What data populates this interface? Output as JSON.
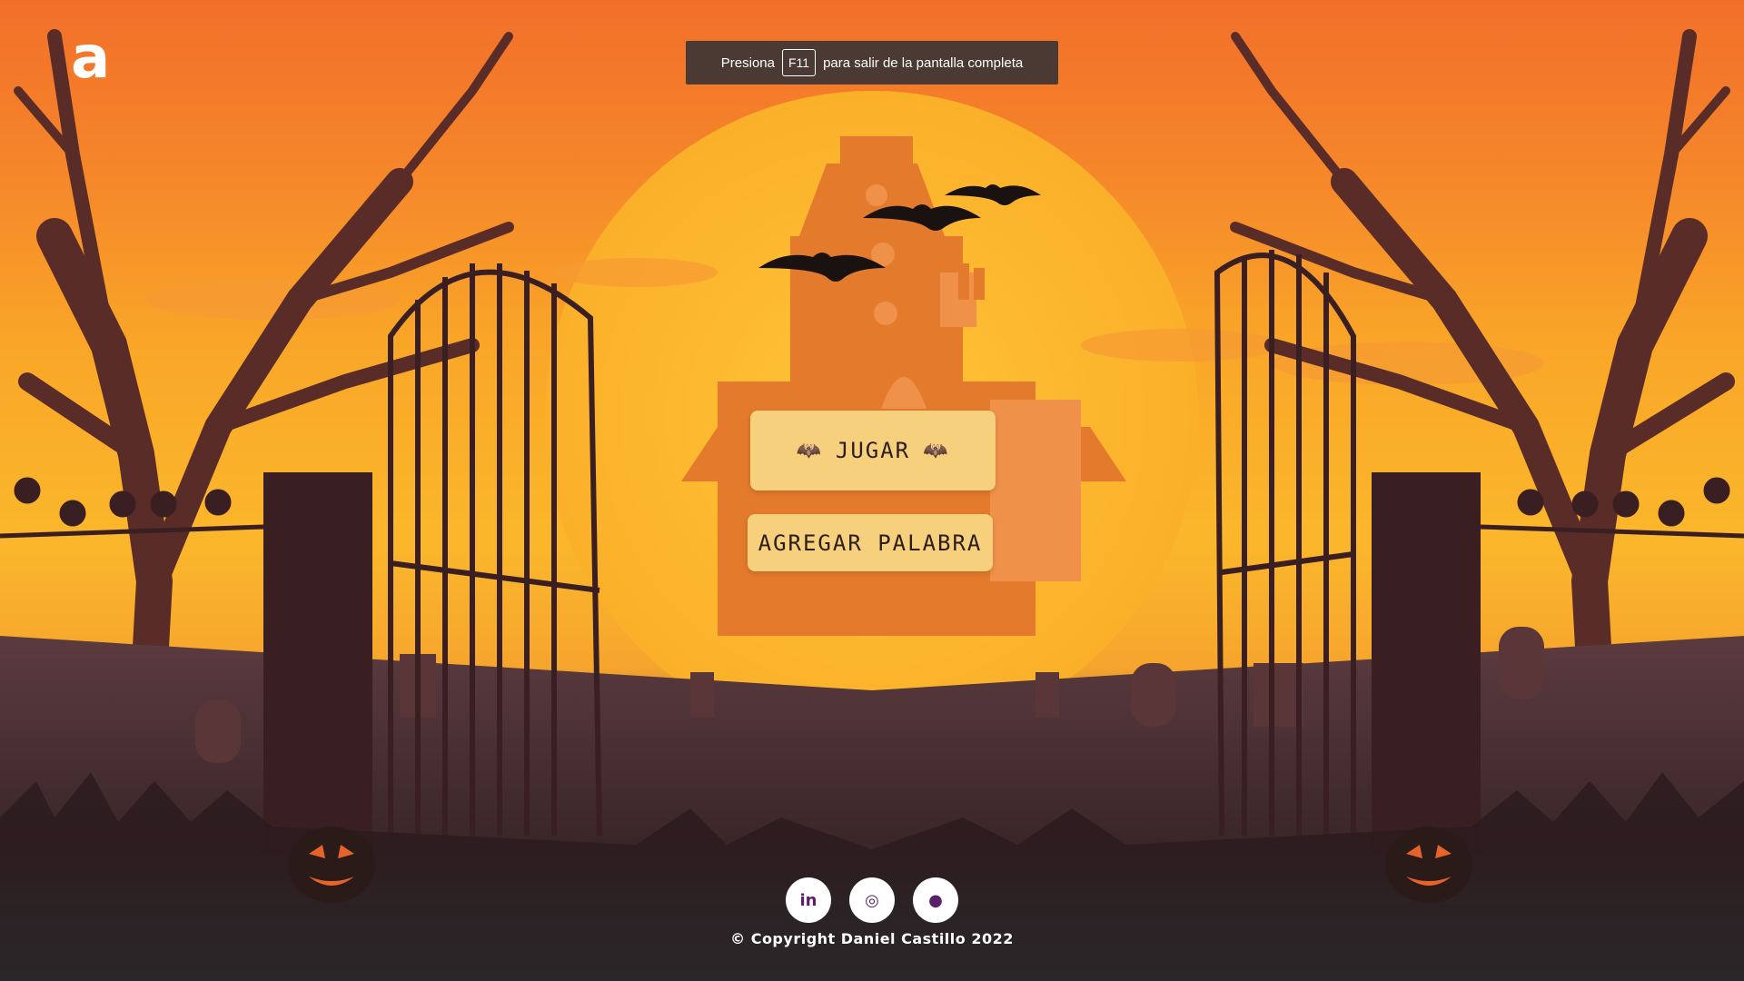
{
  "app": {
    "logo_text": "a"
  },
  "fullscreen_banner": {
    "prefix": "Presiona",
    "key": "F11",
    "suffix": "para salir de la pantalla completa"
  },
  "menu": {
    "play_label": "JUGAR",
    "add_word_label": "AGREGAR PALABRA"
  },
  "footer": {
    "socials": [
      {
        "icon": "linkedin-icon",
        "label": "in"
      },
      {
        "icon": "instagram-icon",
        "label": "◎"
      },
      {
        "icon": "github-icon",
        "label": "●"
      }
    ],
    "copyright": "© Copyright Daniel Castillo 2022"
  },
  "colors": {
    "sky_top": "#f26f2a",
    "sun": "#fbb72b",
    "button_bg": "#f6d07c",
    "silhouette": "#3a1f22",
    "social_icon": "#5a1f6b"
  }
}
